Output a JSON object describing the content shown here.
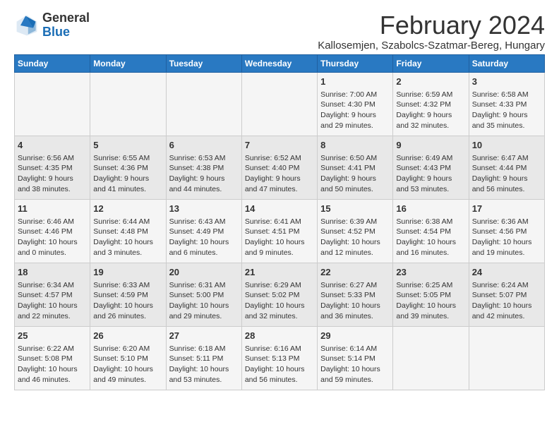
{
  "logo": {
    "line1": "General",
    "line2": "Blue"
  },
  "title": "February 2024",
  "location": "Kallosemjen, Szabolcs-Szatmar-Bereg, Hungary",
  "headers": [
    "Sunday",
    "Monday",
    "Tuesday",
    "Wednesday",
    "Thursday",
    "Friday",
    "Saturday"
  ],
  "weeks": [
    [
      {
        "day": "",
        "sunrise": "",
        "sunset": "",
        "daylight": ""
      },
      {
        "day": "",
        "sunrise": "",
        "sunset": "",
        "daylight": ""
      },
      {
        "day": "",
        "sunrise": "",
        "sunset": "",
        "daylight": ""
      },
      {
        "day": "",
        "sunrise": "",
        "sunset": "",
        "daylight": ""
      },
      {
        "day": "1",
        "sunrise": "Sunrise: 7:00 AM",
        "sunset": "Sunset: 4:30 PM",
        "daylight": "Daylight: 9 hours and 29 minutes."
      },
      {
        "day": "2",
        "sunrise": "Sunrise: 6:59 AM",
        "sunset": "Sunset: 4:32 PM",
        "daylight": "Daylight: 9 hours and 32 minutes."
      },
      {
        "day": "3",
        "sunrise": "Sunrise: 6:58 AM",
        "sunset": "Sunset: 4:33 PM",
        "daylight": "Daylight: 9 hours and 35 minutes."
      }
    ],
    [
      {
        "day": "4",
        "sunrise": "Sunrise: 6:56 AM",
        "sunset": "Sunset: 4:35 PM",
        "daylight": "Daylight: 9 hours and 38 minutes."
      },
      {
        "day": "5",
        "sunrise": "Sunrise: 6:55 AM",
        "sunset": "Sunset: 4:36 PM",
        "daylight": "Daylight: 9 hours and 41 minutes."
      },
      {
        "day": "6",
        "sunrise": "Sunrise: 6:53 AM",
        "sunset": "Sunset: 4:38 PM",
        "daylight": "Daylight: 9 hours and 44 minutes."
      },
      {
        "day": "7",
        "sunrise": "Sunrise: 6:52 AM",
        "sunset": "Sunset: 4:40 PM",
        "daylight": "Daylight: 9 hours and 47 minutes."
      },
      {
        "day": "8",
        "sunrise": "Sunrise: 6:50 AM",
        "sunset": "Sunset: 4:41 PM",
        "daylight": "Daylight: 9 hours and 50 minutes."
      },
      {
        "day": "9",
        "sunrise": "Sunrise: 6:49 AM",
        "sunset": "Sunset: 4:43 PM",
        "daylight": "Daylight: 9 hours and 53 minutes."
      },
      {
        "day": "10",
        "sunrise": "Sunrise: 6:47 AM",
        "sunset": "Sunset: 4:44 PM",
        "daylight": "Daylight: 9 hours and 56 minutes."
      }
    ],
    [
      {
        "day": "11",
        "sunrise": "Sunrise: 6:46 AM",
        "sunset": "Sunset: 4:46 PM",
        "daylight": "Daylight: 10 hours and 0 minutes."
      },
      {
        "day": "12",
        "sunrise": "Sunrise: 6:44 AM",
        "sunset": "Sunset: 4:48 PM",
        "daylight": "Daylight: 10 hours and 3 minutes."
      },
      {
        "day": "13",
        "sunrise": "Sunrise: 6:43 AM",
        "sunset": "Sunset: 4:49 PM",
        "daylight": "Daylight: 10 hours and 6 minutes."
      },
      {
        "day": "14",
        "sunrise": "Sunrise: 6:41 AM",
        "sunset": "Sunset: 4:51 PM",
        "daylight": "Daylight: 10 hours and 9 minutes."
      },
      {
        "day": "15",
        "sunrise": "Sunrise: 6:39 AM",
        "sunset": "Sunset: 4:52 PM",
        "daylight": "Daylight: 10 hours and 12 minutes."
      },
      {
        "day": "16",
        "sunrise": "Sunrise: 6:38 AM",
        "sunset": "Sunset: 4:54 PM",
        "daylight": "Daylight: 10 hours and 16 minutes."
      },
      {
        "day": "17",
        "sunrise": "Sunrise: 6:36 AM",
        "sunset": "Sunset: 4:56 PM",
        "daylight": "Daylight: 10 hours and 19 minutes."
      }
    ],
    [
      {
        "day": "18",
        "sunrise": "Sunrise: 6:34 AM",
        "sunset": "Sunset: 4:57 PM",
        "daylight": "Daylight: 10 hours and 22 minutes."
      },
      {
        "day": "19",
        "sunrise": "Sunrise: 6:33 AM",
        "sunset": "Sunset: 4:59 PM",
        "daylight": "Daylight: 10 hours and 26 minutes."
      },
      {
        "day": "20",
        "sunrise": "Sunrise: 6:31 AM",
        "sunset": "Sunset: 5:00 PM",
        "daylight": "Daylight: 10 hours and 29 minutes."
      },
      {
        "day": "21",
        "sunrise": "Sunrise: 6:29 AM",
        "sunset": "Sunset: 5:02 PM",
        "daylight": "Daylight: 10 hours and 32 minutes."
      },
      {
        "day": "22",
        "sunrise": "Sunrise: 6:27 AM",
        "sunset": "Sunset: 5:33 PM",
        "daylight": "Daylight: 10 hours and 36 minutes."
      },
      {
        "day": "23",
        "sunrise": "Sunrise: 6:25 AM",
        "sunset": "Sunset: 5:05 PM",
        "daylight": "Daylight: 10 hours and 39 minutes."
      },
      {
        "day": "24",
        "sunrise": "Sunrise: 6:24 AM",
        "sunset": "Sunset: 5:07 PM",
        "daylight": "Daylight: 10 hours and 42 minutes."
      }
    ],
    [
      {
        "day": "25",
        "sunrise": "Sunrise: 6:22 AM",
        "sunset": "Sunset: 5:08 PM",
        "daylight": "Daylight: 10 hours and 46 minutes."
      },
      {
        "day": "26",
        "sunrise": "Sunrise: 6:20 AM",
        "sunset": "Sunset: 5:10 PM",
        "daylight": "Daylight: 10 hours and 49 minutes."
      },
      {
        "day": "27",
        "sunrise": "Sunrise: 6:18 AM",
        "sunset": "Sunset: 5:11 PM",
        "daylight": "Daylight: 10 hours and 53 minutes."
      },
      {
        "day": "28",
        "sunrise": "Sunrise: 6:16 AM",
        "sunset": "Sunset: 5:13 PM",
        "daylight": "Daylight: 10 hours and 56 minutes."
      },
      {
        "day": "29",
        "sunrise": "Sunrise: 6:14 AM",
        "sunset": "Sunset: 5:14 PM",
        "daylight": "Daylight: 10 hours and 59 minutes."
      },
      {
        "day": "",
        "sunrise": "",
        "sunset": "",
        "daylight": ""
      },
      {
        "day": "",
        "sunrise": "",
        "sunset": "",
        "daylight": ""
      }
    ]
  ]
}
